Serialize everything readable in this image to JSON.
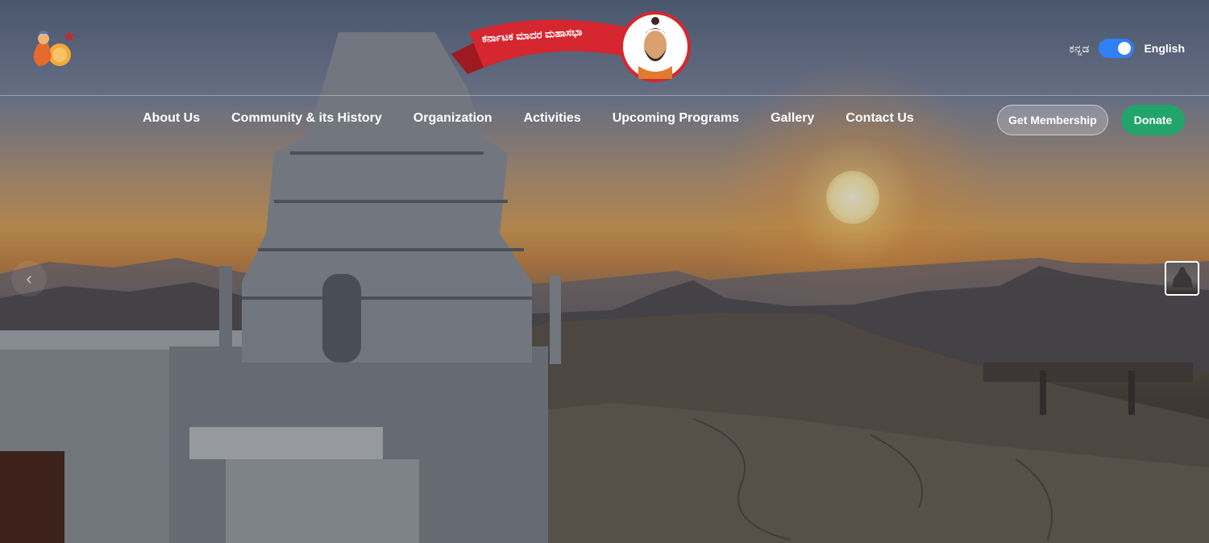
{
  "brand": {
    "banner_text": "ಕರ್ನಾಟಕ ಮಾದರ ಮಹಾಸಭಾ"
  },
  "language": {
    "kannada_label": "ಕನ್ನಡ",
    "english_label": "English",
    "toggle_state": "on"
  },
  "nav": {
    "items": [
      {
        "label": "About Us"
      },
      {
        "label": "Community & its History"
      },
      {
        "label": "Organization"
      },
      {
        "label": "Activities"
      },
      {
        "label": "Upcoming Programs"
      },
      {
        "label": "Gallery"
      },
      {
        "label": "Contact Us"
      }
    ]
  },
  "actions": {
    "membership_label": "Get Membership",
    "donate_label": "Donate"
  },
  "carousel": {
    "prev_icon": "chevron-left-icon",
    "prev_symbol": "‹"
  },
  "colors": {
    "accent_blue": "#2f7ff5",
    "donate_green": "#23a46b",
    "banner_red": "#d6262f"
  }
}
